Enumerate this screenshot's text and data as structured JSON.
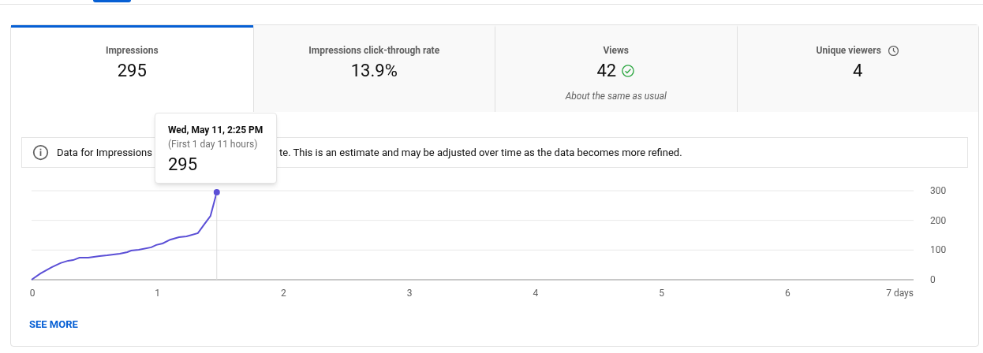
{
  "metrics": [
    {
      "kind": "plain",
      "title": "Impressions",
      "value": "295",
      "selected": true
    },
    {
      "kind": "plain",
      "title": "Impressions click-through rate",
      "value": "13.9%",
      "selected": false
    },
    {
      "kind": "status",
      "title": "Views",
      "value": "42",
      "selected": false,
      "note": "About the same as usual"
    },
    {
      "kind": "timed",
      "title": "Unique viewers",
      "value": "4",
      "selected": false
    }
  ],
  "info_banner": {
    "text_start": "Data for Impressions",
    "text_end": "te. This is an estimate and may be adjusted over time as the data becomes more refined."
  },
  "tooltip": {
    "date": "Wed, May 11, 2:25 PM",
    "period": "(First 1 day 11 hours)",
    "value": "295"
  },
  "chart_data": {
    "type": "line",
    "xlim": [
      0,
      7
    ],
    "ylim": [
      0,
      300
    ],
    "xticks": [
      0,
      1,
      2,
      3,
      4,
      5,
      6,
      {
        "value": 7,
        "label": "7 days"
      }
    ],
    "yticks": [
      0,
      100,
      200,
      300
    ],
    "ref_lines": [
      {
        "axis": "x",
        "value": 1.47
      }
    ],
    "x": [
      0,
      0.07,
      0.16,
      0.23,
      0.29,
      0.33,
      0.38,
      0.45,
      0.54,
      0.6,
      0.7,
      0.76,
      0.79,
      0.85,
      0.95,
      0.99,
      1.04,
      1.1,
      1.17,
      1.23,
      1.32,
      1.37,
      1.42,
      1.47
    ],
    "series": [
      {
        "color": "#5b4fd6",
        "values": [
          0,
          21,
          42,
          56,
          64,
          66,
          74,
          74,
          80,
          82,
          88,
          93,
          98,
          101,
          109,
          117,
          122,
          135,
          143,
          146,
          157,
          186,
          215,
          295
        ]
      }
    ]
  },
  "see_more": "SEE MORE"
}
